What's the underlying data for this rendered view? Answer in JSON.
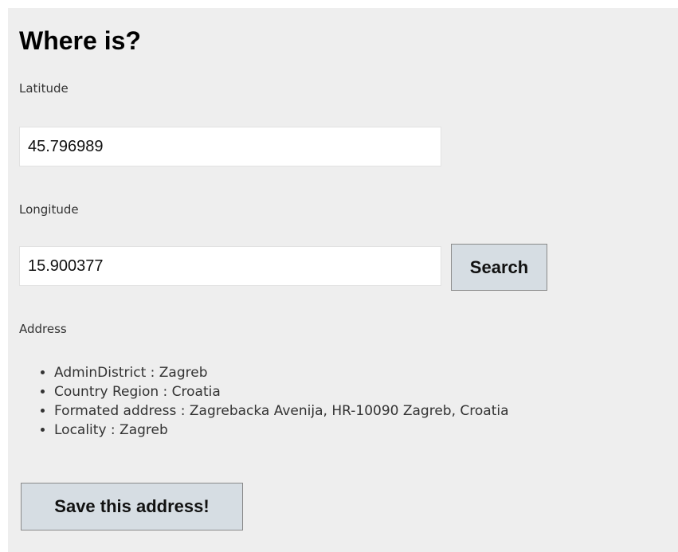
{
  "page": {
    "title": "Where is?"
  },
  "latitude": {
    "label": "Latitude",
    "value": "45.796989"
  },
  "longitude": {
    "label": "Longitude",
    "value": "15.900377"
  },
  "search_button": {
    "label": "Search"
  },
  "address": {
    "label": "Address",
    "items": [
      "AdminDistrict : Zagreb",
      "Country Region : Croatia",
      "Formated address : Zagrebacka Avenija, HR-10090 Zagreb, Croatia",
      "Locality : Zagreb"
    ]
  },
  "save_button": {
    "label": "Save this address!"
  },
  "colors": {
    "panel_background": "#eeeeee",
    "button_background": "#d6dde3"
  }
}
